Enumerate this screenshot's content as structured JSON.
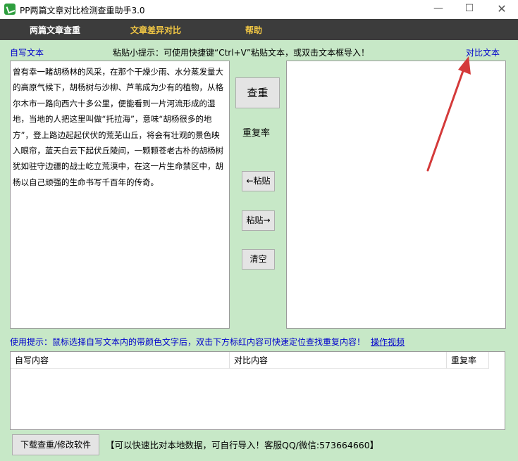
{
  "window": {
    "title": "PP两篇文章对比检测查重助手3.0",
    "minimize": "—",
    "maximize": "☐",
    "close": "✕"
  },
  "menu": {
    "items": [
      "两篇文章查重",
      "文章差异对比",
      "帮助"
    ]
  },
  "labels": {
    "self_text": "自写文本",
    "paste_tip": "粘贴小提示：可使用快捷键“Ctrl+V”粘贴文本，或双击文本框导入！",
    "compare_text": "对比文本",
    "use_tip": "使用提示：鼠标选择自写文本内的带颜色文字后，双击下方标红内容可快速定位查找重复内容！",
    "video_link": "操作视频",
    "dup_rate": "重复率"
  },
  "self_text_content": "曾有幸一睹胡杨林的风采，在那个干燥少雨、水分蒸发量大的高原气候下，胡杨树与沙柳、芦苇成为少有的植物，从格尔木市一路向西六十多公里，便能看到一片河流形成的湿地，当地的人把这里叫做“托拉海”，意味“胡杨很多的地方”，登上路边起起伏伏的荒芜山丘，将会有壮观的景色映入眼帘，蓝天白云下起伏丘陵间，一颗颗苍老古朴的胡杨树犹如驻守边疆的战士屹立荒漠中，在这一片生命禁区中，胡杨以自己顽强的生命书写千百年的传奇。",
  "compare_text_content": "",
  "buttons": {
    "check": "查重",
    "paste_left": "←粘贴",
    "paste_right": "粘贴→",
    "clear": "清空",
    "download": "下载查重/修改软件"
  },
  "table": {
    "headers": [
      "自写内容",
      "对比内容",
      "重复率"
    ]
  },
  "bottom_note": "【可以快速比对本地数据，可自行导入！客服QQ/微信:573664660】",
  "colors": {
    "background": "#c7e8c7",
    "menubar": "#3c3c3c",
    "menu_accent": "#f2c744",
    "link_blue": "#0000cc",
    "arrow": "#d43a3a"
  }
}
